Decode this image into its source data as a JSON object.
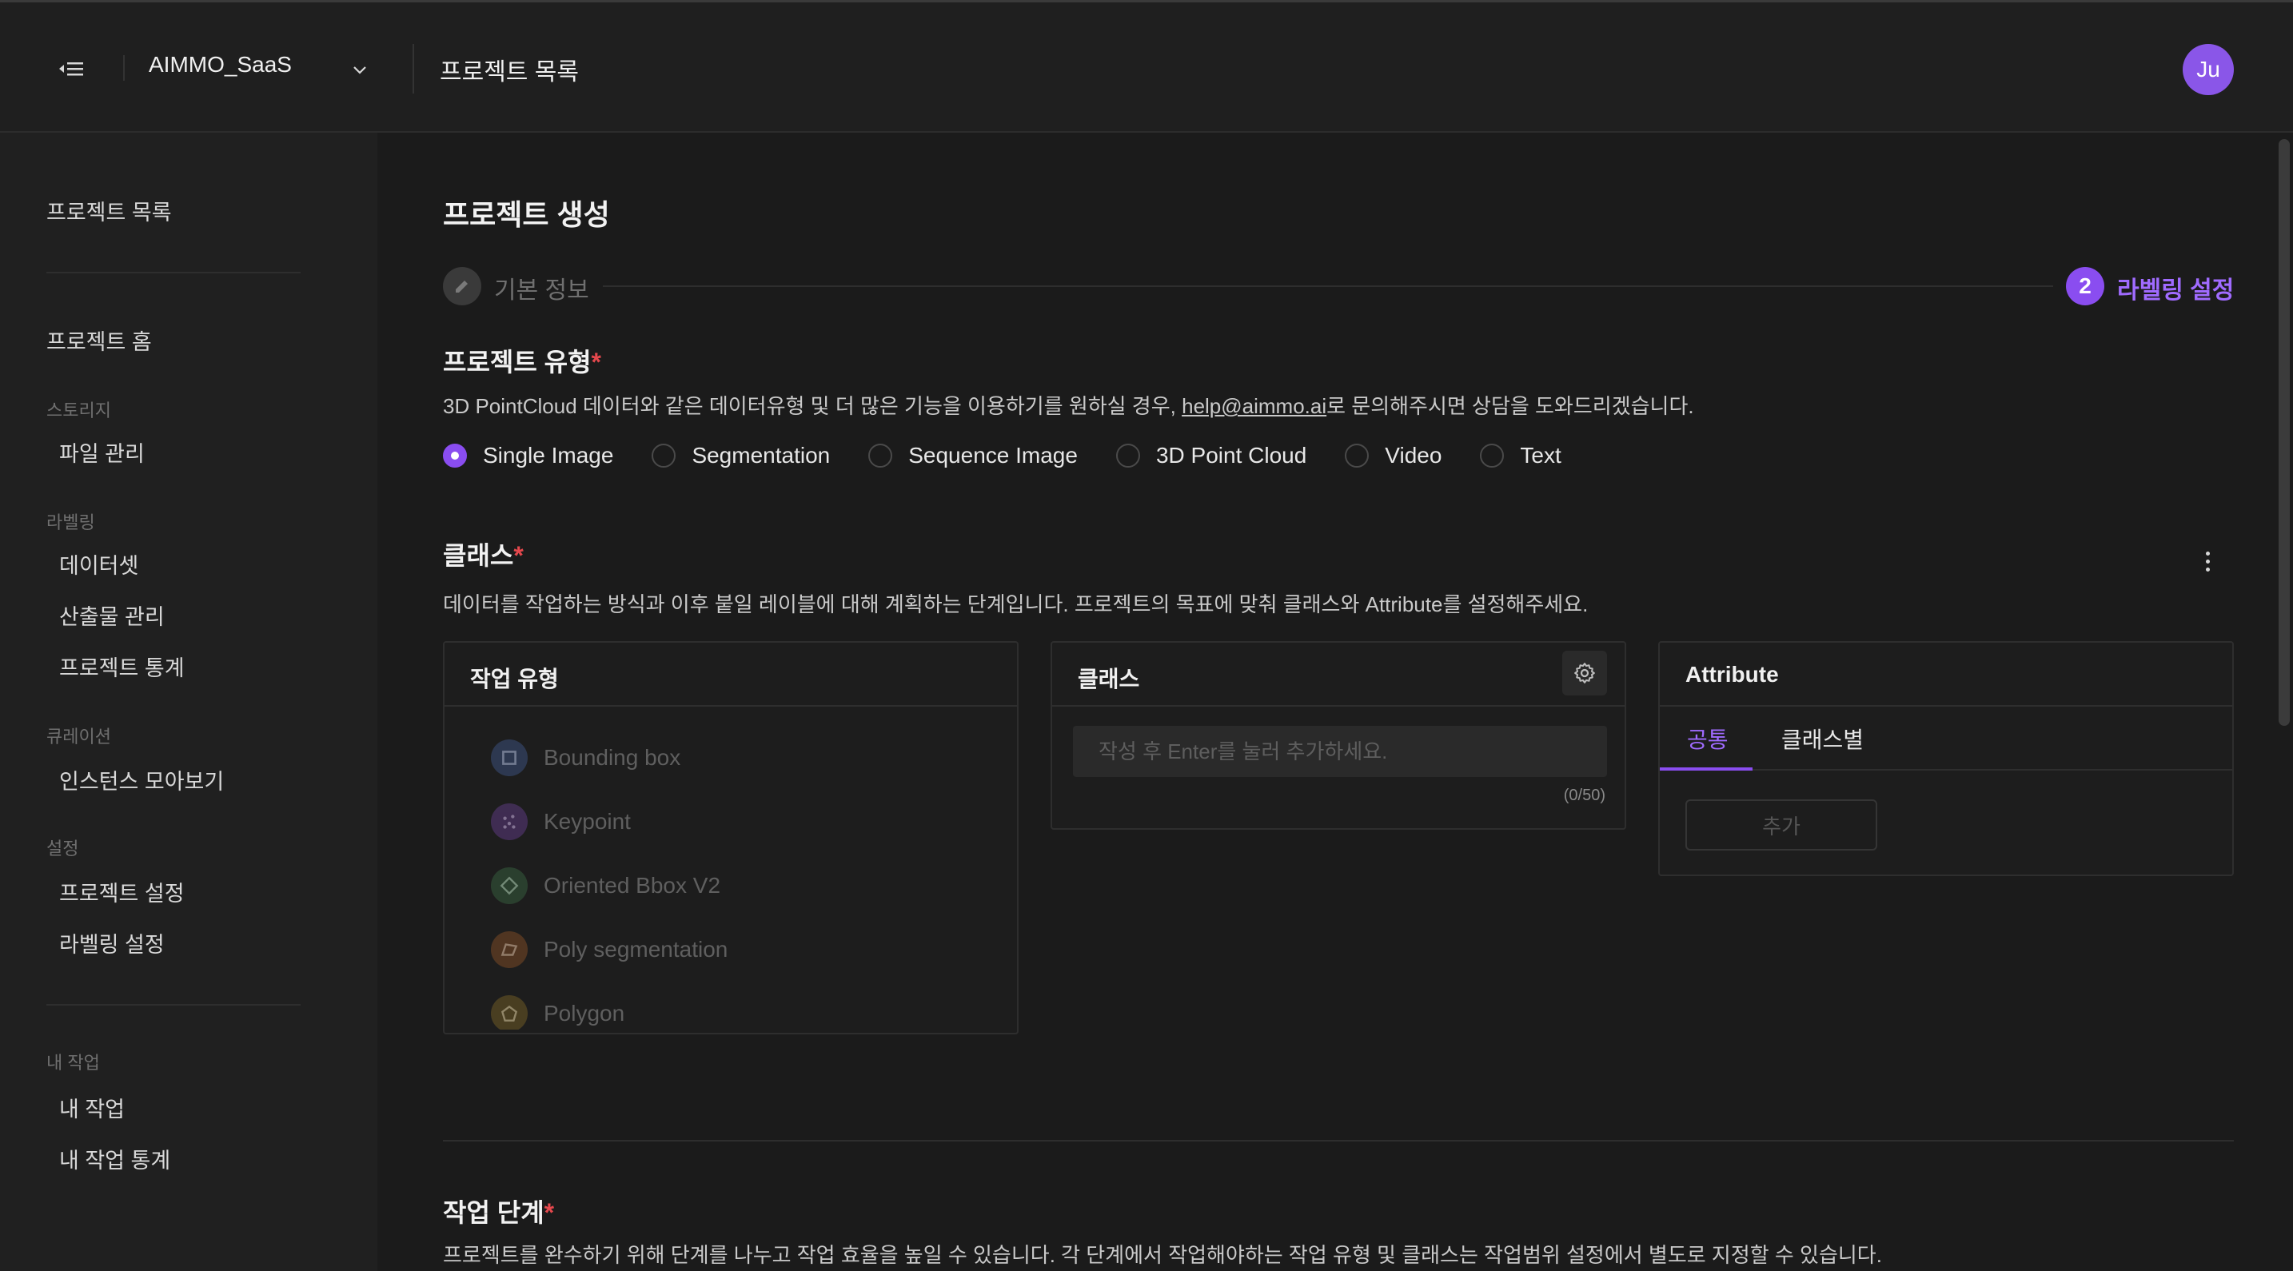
{
  "header": {
    "workspace": "AIMMO_SaaS",
    "page_title": "프로젝트 목록",
    "avatar_initials": "Ju"
  },
  "sidebar": {
    "top_item": "프로젝트 목록",
    "home": "프로젝트 홈",
    "sections": [
      {
        "title": "스토리지",
        "items": [
          "파일 관리"
        ]
      },
      {
        "title": "라벨링",
        "items": [
          "데이터셋",
          "산출물 관리",
          "프로젝트 통계"
        ]
      },
      {
        "title": "큐레이션",
        "items": [
          "인스턴스 모아보기"
        ]
      },
      {
        "title": "설정",
        "items": [
          "프로젝트 설정",
          "라벨링 설정"
        ]
      },
      {
        "title": "내 작업",
        "items": [
          "내 작업",
          "내 작업 통계"
        ]
      }
    ]
  },
  "main": {
    "title": "프로젝트 생성",
    "steps": [
      {
        "number": "",
        "label": "기본 정보",
        "state": "done"
      },
      {
        "number": "2",
        "label": "라벨링 설정",
        "state": "active"
      }
    ],
    "project_type": {
      "title": "프로젝트 유형",
      "required_mark": "*",
      "desc_before": "3D PointCloud 데이터와 같은 데이터유형 및 더 많은 기능을 이용하기를 원하실 경우, ",
      "desc_link": "help@aimmo.ai",
      "desc_after": "로 문의해주시면 상담을 도와드리겠습니다.",
      "options": [
        "Single Image",
        "Segmentation",
        "Sequence Image",
        "3D Point Cloud",
        "Video",
        "Text"
      ],
      "selected": "Single Image"
    },
    "classes_section": {
      "title": "클래스",
      "required_mark": "*",
      "desc": "데이터를 작업하는 방식과 이후 붙일 레이블에 대해 계획하는 단계입니다. 프로젝트의 목표에 맞춰 클래스와 Attribute를 설정해주세요."
    },
    "work_type_panel": {
      "title": "작업 유형",
      "items": [
        {
          "label": "Bounding box",
          "icon": "bounding-box-icon",
          "color": "#6f8fd8"
        },
        {
          "label": "Keypoint",
          "icon": "keypoint-icon",
          "color": "#a46be0"
        },
        {
          "label": "Oriented Bbox V2",
          "icon": "oriented-bbox-icon",
          "color": "#5fa86a"
        },
        {
          "label": "Poly segmentation",
          "icon": "poly-segmentation-icon",
          "color": "#d08a4a"
        },
        {
          "label": "Polygon",
          "icon": "polygon-icon",
          "color": "#c9a64a"
        }
      ]
    },
    "class_panel": {
      "title": "클래스",
      "placeholder": "작성 후 Enter를 눌러 추가하세요.",
      "counter": "(0/50)"
    },
    "attribute_panel": {
      "title": "Attribute",
      "tabs": [
        "공통",
        "클래스별"
      ],
      "active_tab": "공통",
      "add_label": "추가"
    },
    "work_stage": {
      "title": "작업 단계",
      "required_mark": "*",
      "desc": "프로젝트를 완수하기 위해 단계를 나누고 작업 효율을 높일 수 있습니다. 각 단계에서 작업해야하는 작업 유형 및 클래스는 작업범위 설정에서 별도로 지정할 수 있습니다."
    }
  },
  "colors": {
    "accent": "#8a4df0",
    "accent_text": "#a06bff",
    "required": "#e5484d",
    "background": "#1b1b1b",
    "sidebar": "#202020"
  }
}
